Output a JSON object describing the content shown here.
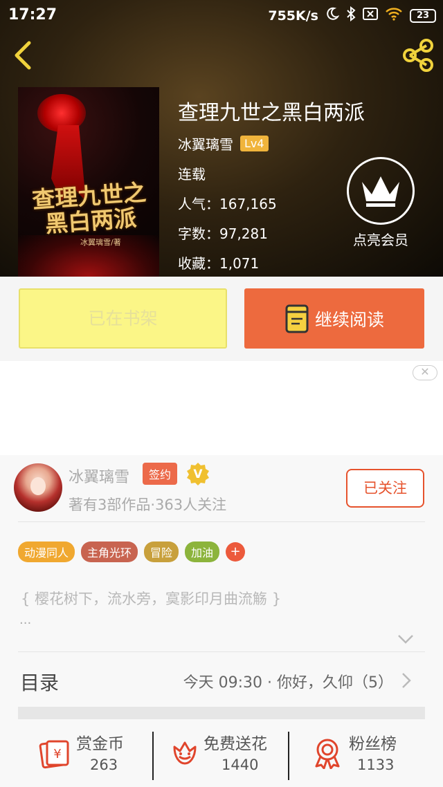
{
  "status_bar": {
    "time": "17:27",
    "network_speed": "755K/s",
    "battery": "23"
  },
  "book": {
    "title": "查理九世之黑白两派",
    "cover_title": "查理九世之黑白两派",
    "cover_author": "冰翼璃雪/著",
    "author": "冰翼璃雪",
    "level": "Lv4",
    "status": "连载",
    "popularity_line": "人气：167,165",
    "word_count_line": "字数：97,281",
    "favorites_line": "收藏：1,071"
  },
  "vip": {
    "label": "点亮会员"
  },
  "actions": {
    "shelf_label": "已在书架",
    "read_label": "继续阅读"
  },
  "ad": {
    "close_icon": "close-icon"
  },
  "author_card": {
    "name": "冰翼璃雪",
    "sign_badge": "签约",
    "verified_badge": "V",
    "subtitle": "著有3部作品·363人关注",
    "follow_label": "已关注"
  },
  "tags": [
    {
      "label": "动漫同人",
      "color": "#f0a830"
    },
    {
      "label": "主角光环",
      "color": "#c86450"
    },
    {
      "label": "冒险",
      "color": "#c8a03c"
    },
    {
      "label": "加油",
      "color": "#8cb43c"
    }
  ],
  "tag_more": "+",
  "intro": {
    "text": "{ 樱花树下，流水旁，寞影印月曲流觞 }",
    "ellipsis": "..."
  },
  "toc": {
    "title": "目录",
    "latest": "今天 09:30 · 你好，久仰（5）"
  },
  "stats": [
    {
      "label": "赏金币",
      "value": "263",
      "icon": "reward-coin-icon"
    },
    {
      "label": "免费送花",
      "value": "1440",
      "icon": "flower-icon"
    },
    {
      "label": "粉丝榜",
      "value": "1133",
      "icon": "fan-rank-icon"
    }
  ],
  "colors": {
    "accent": "#ed6a3e",
    "shelf_button": "#fbf687",
    "level_badge": "#f0b43c",
    "sign_badge": "#ec6a4a",
    "follow_border": "#e6522c"
  }
}
